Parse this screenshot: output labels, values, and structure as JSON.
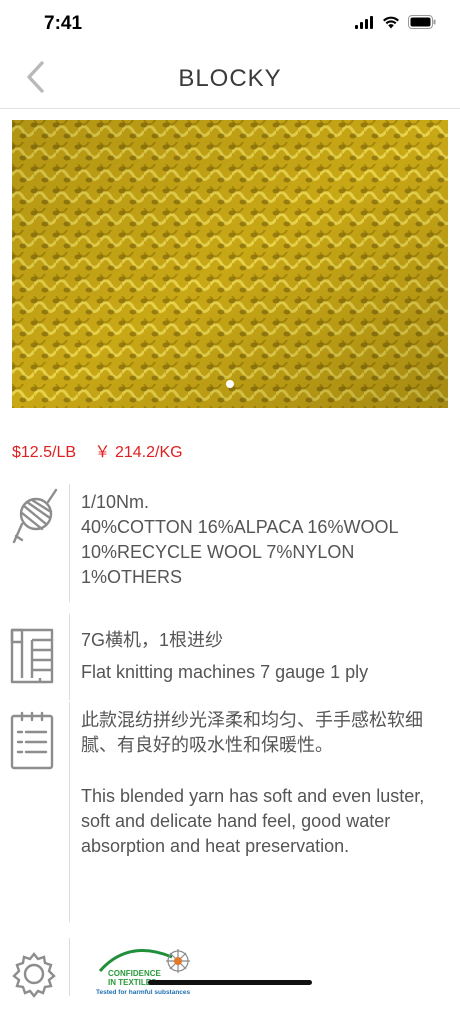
{
  "status": {
    "time": "7:41"
  },
  "nav": {
    "title": "BLOCKY"
  },
  "prices": {
    "per_lb": "$12.5/LB",
    "per_kg": "￥ 214.2/KG"
  },
  "yarn_spec": {
    "count": "1/10Nm.",
    "composition": "40%COTTON 16%ALPACA 16%WOOL 10%RECYCLE WOOL 7%NYLON 1%OTHERS"
  },
  "machine": {
    "cn": "7G横机，1根进纱",
    "en": "Flat knitting machines 7 gauge 1 ply"
  },
  "description": {
    "cn": "此款混纺拼纱光泽柔和均匀、手手感松软细腻、有良好的吸水性和保暖性。",
    "en": "This blended yarn has soft and even luster, soft and delicate hand feel, good water absorption and heat preservation."
  },
  "certification": {
    "logo_line1": "CONFIDENCE",
    "logo_line2": "IN TEXTILES",
    "logo_line3": "Tested for harmful substances"
  },
  "colors": {
    "price": "#e02020",
    "fabric": "#c9a816"
  }
}
